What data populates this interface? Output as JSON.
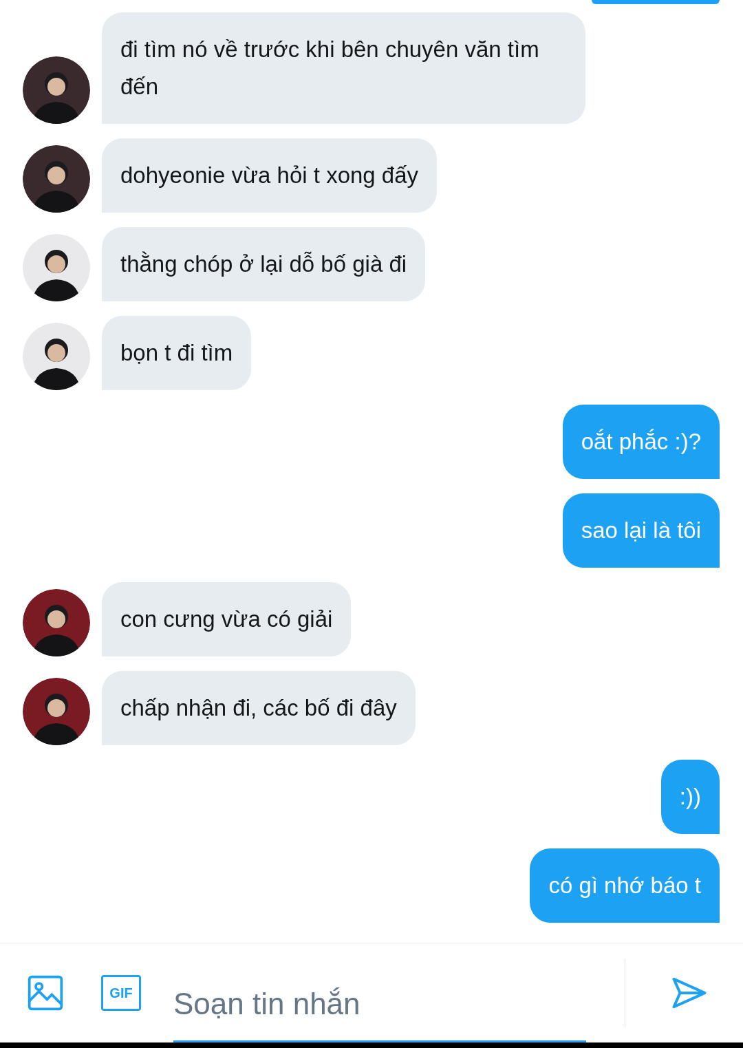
{
  "messages": [
    {
      "kind": "clipped_outgoing"
    },
    {
      "kind": "incoming",
      "color": "#3a2a2e",
      "text": "đi tìm nó về trước khi bên chuyên văn tìm đến"
    },
    {
      "kind": "incoming",
      "color": "#3a2a2e",
      "text": "dohyeonie vừa hỏi t xong đấy"
    },
    {
      "kind": "incoming",
      "color": "#e9e9ec",
      "text": "thằng chóp ở lại dỗ bố già đi"
    },
    {
      "kind": "incoming",
      "color": "#e9e9ec",
      "text": "bọn t đi tìm"
    },
    {
      "kind": "outgoing",
      "text": "oắt phắc :)?"
    },
    {
      "kind": "outgoing",
      "text": "sao lại là tôi"
    },
    {
      "kind": "incoming",
      "color": "#7a1a22",
      "text": "con cưng vừa có giải"
    },
    {
      "kind": "incoming",
      "color": "#7a1a22",
      "text": "chấp nhận đi, các bố đi đây"
    },
    {
      "kind": "outgoing",
      "text": ":))"
    },
    {
      "kind": "outgoing",
      "text": "có gì nhớ báo t"
    }
  ],
  "composer": {
    "gif_label": "GIF",
    "placeholder": "Soạn tin nhắn"
  }
}
